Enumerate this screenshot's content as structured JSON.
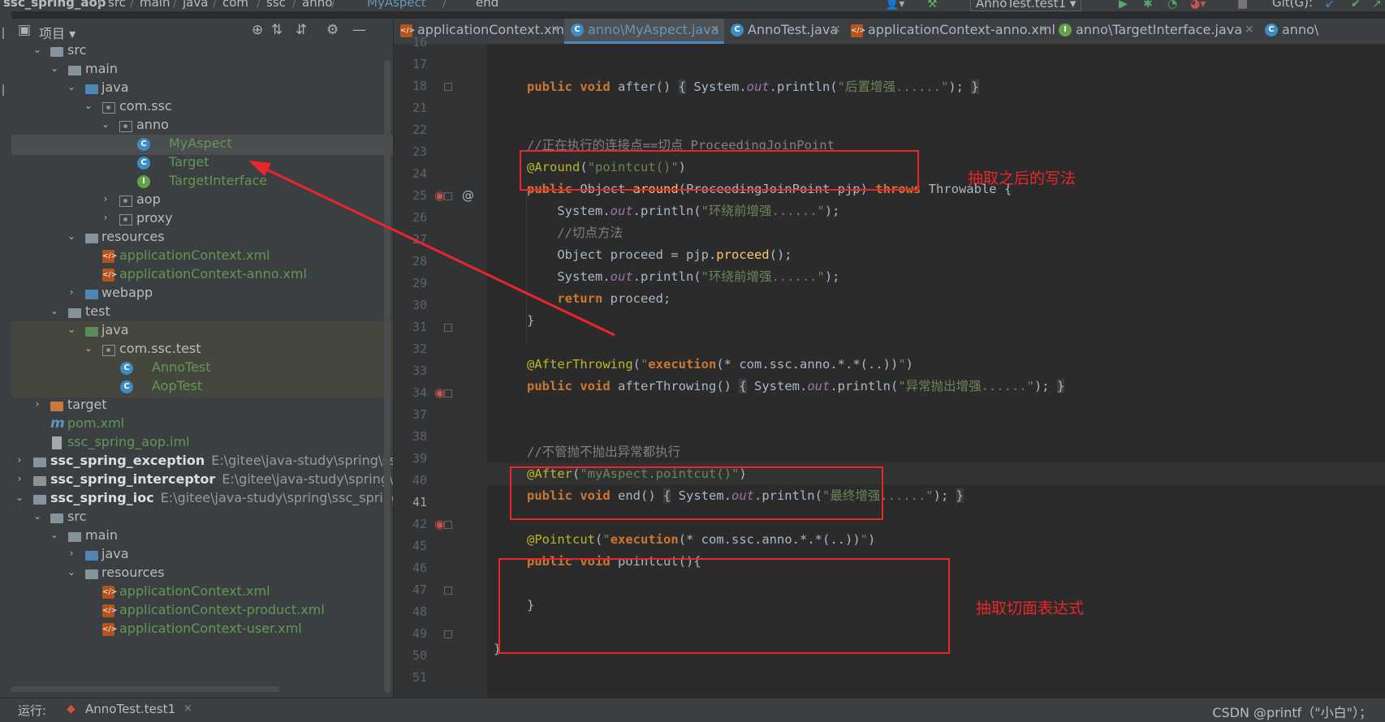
{
  "breadcrumbs": [
    "ssc_spring_aop",
    "src",
    "main",
    "java",
    "com",
    "ssc",
    "anno",
    "MyAspect",
    "end"
  ],
  "toolbar": {
    "run_config": "AnnoTest.test1",
    "git_label": "Git(G):"
  },
  "project_panel": {
    "title": "项目"
  },
  "tree": [
    {
      "label": "src",
      "icon": "folder-icon"
    },
    {
      "label": "main",
      "icon": "folder-icon"
    },
    {
      "label": "java",
      "icon": "source-folder-icon"
    },
    {
      "label": "com.ssc",
      "icon": "package-icon"
    },
    {
      "label": "anno",
      "icon": "package-icon"
    },
    {
      "label": "MyAspect",
      "icon": "class-icon"
    },
    {
      "label": "Target",
      "icon": "class-icon"
    },
    {
      "label": "TargetInterface",
      "icon": "interface-icon"
    },
    {
      "label": "aop",
      "icon": "package-icon"
    },
    {
      "label": "proxy",
      "icon": "package-icon"
    },
    {
      "label": "resources",
      "icon": "resources-folder-icon"
    },
    {
      "label": "applicationContext.xml",
      "icon": "xml-file-icon"
    },
    {
      "label": "applicationContext-anno.xml",
      "icon": "xml-file-icon"
    },
    {
      "label": "webapp",
      "icon": "web-folder-icon"
    },
    {
      "label": "test",
      "icon": "folder-icon"
    },
    {
      "label": "java",
      "icon": "test-folder-icon"
    },
    {
      "label": "com.ssc.test",
      "icon": "package-icon"
    },
    {
      "label": "AnnoTest",
      "icon": "test-class-icon"
    },
    {
      "label": "AopTest",
      "icon": "test-class-icon"
    },
    {
      "label": "target",
      "icon": "excluded-folder-icon"
    },
    {
      "label": "pom.xml",
      "icon": "maven-icon"
    },
    {
      "label": "ssc_spring_aop.iml",
      "icon": "iml-file-icon"
    },
    {
      "label": "ssc_spring_exception",
      "path": "E:\\gitee\\java-study\\spring\\ssc_s",
      "icon": "module-icon"
    },
    {
      "label": "ssc_spring_interceptor",
      "path": "E:\\gitee\\java-study\\spring\\ssc",
      "icon": "module-icon"
    },
    {
      "label": "ssc_spring_ioc",
      "path": "E:\\gitee\\java-study\\spring\\ssc_spring_ic",
      "icon": "module-icon"
    },
    {
      "label": "src",
      "icon": "folder-icon"
    },
    {
      "label": "main",
      "icon": "folder-icon"
    },
    {
      "label": "java",
      "icon": "source-folder-icon"
    },
    {
      "label": "resources",
      "icon": "resources-folder-icon"
    },
    {
      "label": "applicationContext.xml",
      "icon": "xml-file-icon"
    },
    {
      "label": "applicationContext-product.xml",
      "icon": "xml-file-icon"
    },
    {
      "label": "applicationContext-user.xml",
      "icon": "xml-file-icon"
    }
  ],
  "tabs": [
    {
      "label": "applicationContext.xml",
      "icon": "xml-file-icon"
    },
    {
      "label": "anno\\MyAspect.java",
      "icon": "class-icon",
      "active": true
    },
    {
      "label": "AnnoTest.java",
      "icon": "test-class-icon"
    },
    {
      "label": "applicationContext-anno.xml",
      "icon": "xml-file-icon"
    },
    {
      "label": "anno\\TargetInterface.java",
      "icon": "interface-icon"
    },
    {
      "label": "anno\\",
      "icon": "class-icon"
    }
  ],
  "line_numbers": [
    "16",
    "17",
    "18",
    "21",
    "22",
    "23",
    "24",
    "25",
    "26",
    "27",
    "28",
    "29",
    "30",
    "31",
    "32",
    "33",
    "34",
    "37",
    "38",
    "39",
    "40",
    "41",
    "42",
    "45",
    "46",
    "47",
    "48",
    "49",
    "50",
    "51"
  ],
  "current_line": "41",
  "code": {
    "l18": {
      "kw1": "public void ",
      "m": "after",
      "p1": "() ",
      "b1": "{",
      "s1": " System.",
      "f": "out",
      "s2": ".println(",
      "str": "\"后置增强......\"",
      "s3": ");",
      "b2": "}"
    },
    "l23": {
      "c": "//正在执行的连接点==切点 ProceedingJoinPoint"
    },
    "l24": {
      "a": "@Around",
      "p1": "(",
      "str": "\"pointcut()\"",
      "p2": ")"
    },
    "l25": {
      "kw1": "public ",
      "t1": "Object ",
      "m": "around",
      "p1": "(ProceedingJoinPoint pjp) ",
      "kw2": "throws ",
      "t2": "Throwable {"
    },
    "l26": {
      "s1": "    System.",
      "f": "out",
      "s2": ".println(",
      "str": "\"环绕前增强......\"",
      "s3": ");"
    },
    "l27": {
      "c": "    //切点方法"
    },
    "l28": {
      "s1": "    Object proceed = pjp.",
      "m": "proceed",
      "s2": "();"
    },
    "l29": {
      "s1": "    System.",
      "f": "out",
      "s2": ".println(",
      "str": "\"环绕前增强......\"",
      "s3": ");"
    },
    "l30": {
      "kw": "    return ",
      "s1": "proceed;"
    },
    "l31": {
      "s1": "}"
    },
    "l33": {
      "a": "@AfterThrowing",
      "p1": "(",
      "q1": "\"",
      "ex": "execution",
      "q2": "(* com.ssc.anno.*.*(..))",
      "q3": "\"",
      "p2": ")"
    },
    "l34": {
      "kw1": "public void ",
      "m": "afterThrowing",
      "p1": "() ",
      "b1": "{",
      "s1": " System.",
      "f": "out",
      "s2": ".println(",
      "str": "\"异常抛出增强......\"",
      "s3": ");",
      "b2": "}"
    },
    "l40": {
      "c": "//不管抛不抛出异常都执行"
    },
    "l41": {
      "a": "@After",
      "p1": "(",
      "str": "\"myAspect.pointcut()\"",
      "p2": ")"
    },
    "l42": {
      "kw1": "public void ",
      "m": "end",
      "p1": "() ",
      "b1": "{",
      "s1": " System.",
      "f": "out",
      "s2": ".println(",
      "str": "\"最终增强......\"",
      "s3": ");",
      "b2": "}"
    },
    "l46": {
      "a": "@Pointcut",
      "p1": "(",
      "q1": "\"",
      "ex": "execution",
      "q2": "(* com.ssc.anno.*.*(..))",
      "q3": "\"",
      "p2": ")"
    },
    "l47": {
      "kw1": "public void ",
      "m": "pointcut",
      "p1": "(){"
    },
    "l49": {
      "s1": "}"
    },
    "l51": {
      "s1": "}"
    }
  },
  "annotations": {
    "after_refactor": "抽取之后的写法",
    "extract_pointcut": "抽取切面表达式"
  },
  "status": {
    "run_label": "运行:",
    "run_tab": "AnnoTest.test1",
    "watermark": "CSDN @printf（\"小白\"）；"
  },
  "colors": {
    "highlight_red": "#e8262b",
    "keyword": "#cc7832",
    "annotation": "#bbb529",
    "string": "#6a8759",
    "comment": "#808080"
  }
}
